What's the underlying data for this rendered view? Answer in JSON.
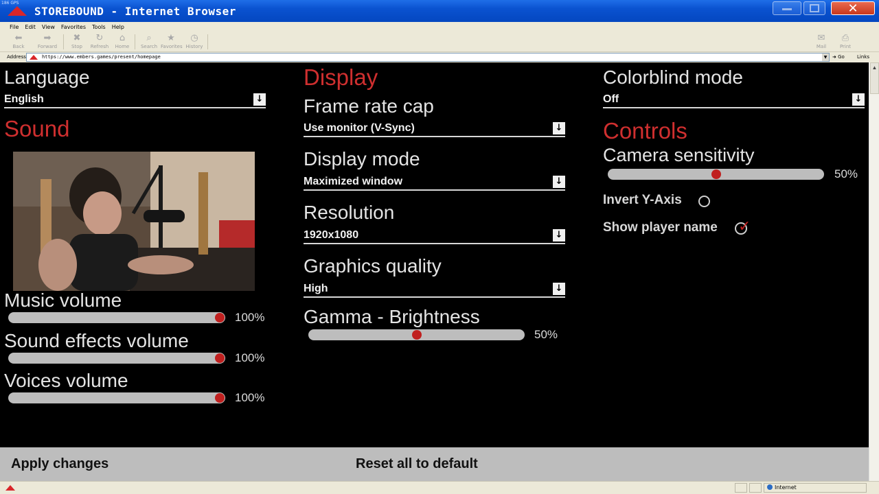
{
  "browser": {
    "fps_text": "186 GPS",
    "title": "STOREBOUND - Internet Browser",
    "menu": [
      "File",
      "Edit",
      "View",
      "Favorites",
      "Tools",
      "Help"
    ],
    "toolbar": {
      "back": "Back",
      "forward": "Forward",
      "stop": "Stop",
      "refresh": "Refresh",
      "home": "Home",
      "search": "Search",
      "favorites": "Favorites",
      "history": "History",
      "mail": "Mail",
      "print": "Print"
    },
    "address_label": "Address",
    "url": "https://www.embers.games/present/homepage",
    "go_label": "Go",
    "links_label": "Links",
    "status_zone": "Internet",
    "accent": "#cf2f2f"
  },
  "settings": {
    "language": {
      "label": "Language",
      "value": "English"
    },
    "sound": {
      "heading": "Sound",
      "music": {
        "label": "Music volume",
        "value": 100,
        "display": "100%"
      },
      "sfx": {
        "label": "Sound effects volume",
        "value": 100,
        "display": "100%"
      },
      "voices": {
        "label": "Voices volume",
        "value": 100,
        "display": "100%"
      }
    },
    "display": {
      "heading": "Display",
      "frame_rate": {
        "label": "Frame rate cap",
        "value": "Use monitor (V-Sync)"
      },
      "display_mode": {
        "label": "Display mode",
        "value": "Maximized window"
      },
      "resolution": {
        "label": "Resolution",
        "value": "1920x1080"
      },
      "graphics": {
        "label": "Graphics quality",
        "value": "High"
      },
      "gamma": {
        "label": "Gamma - Brightness",
        "value": 50,
        "display": "50%"
      }
    },
    "colorblind": {
      "label": "Colorblind mode",
      "value": "Off"
    },
    "controls": {
      "heading": "Controls",
      "camera": {
        "label": "Camera sensitivity",
        "value": 50,
        "display": "50%"
      },
      "invert_y": {
        "label": "Invert Y-Axis",
        "checked": false
      },
      "show_name": {
        "label": "Show player name",
        "checked": true
      }
    },
    "apply_label": "Apply changes",
    "reset_label": "Reset all to default"
  }
}
